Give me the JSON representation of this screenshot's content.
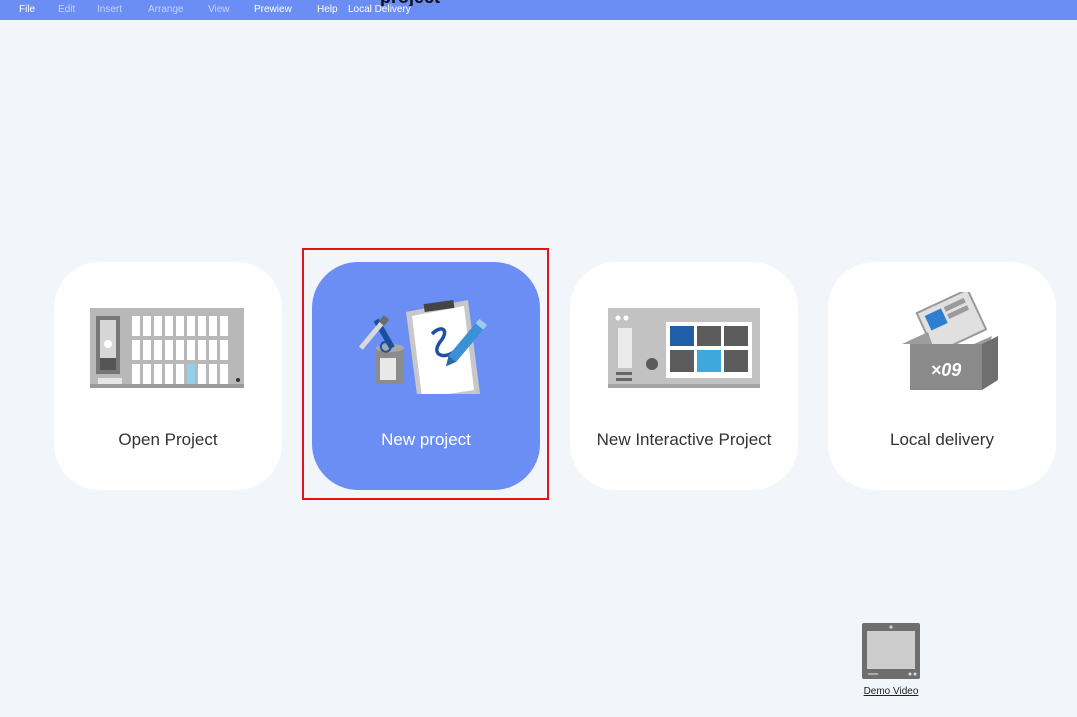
{
  "menu": {
    "items": [
      {
        "label": "File",
        "enabled": true
      },
      {
        "label": "Edit",
        "enabled": false
      },
      {
        "label": "Insert",
        "enabled": false
      },
      {
        "label": "Arrange",
        "enabled": false
      },
      {
        "label": "View",
        "enabled": false
      },
      {
        "label": "Prewiew",
        "enabled": true
      },
      {
        "label": "Help",
        "enabled": true
      },
      {
        "label": "Local Delivery",
        "enabled": true
      }
    ]
  },
  "top_title": "project",
  "tiles": [
    {
      "label": "Open Project",
      "icon": "open-project-icon"
    },
    {
      "label": "New project",
      "icon": "new-project-icon",
      "active": true
    },
    {
      "label": "New Interactive Project",
      "icon": "interactive-project-icon"
    },
    {
      "label": "Local delivery",
      "icon": "local-delivery-icon",
      "box_text": "×09"
    }
  ],
  "demo_video": {
    "label": "Demo Video",
    "icon": "monitor-icon"
  },
  "colors": {
    "accent": "#6b8ef5",
    "background": "#f2f6fb",
    "highlight": "#e0151b",
    "tile": "#ffffff"
  }
}
